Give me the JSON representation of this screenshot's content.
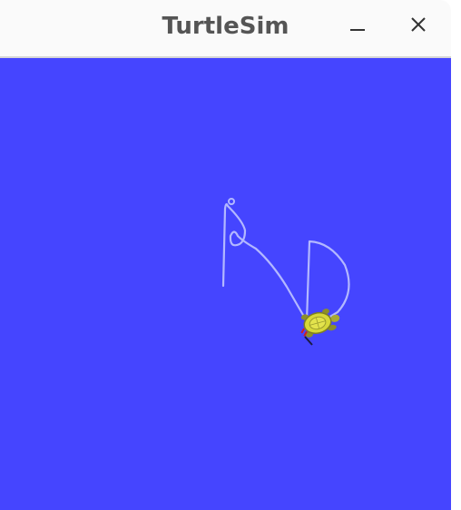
{
  "window": {
    "title": "TurtleSim"
  },
  "titlebar": {
    "minimize_icon": "minimize-icon",
    "close_icon": "close-icon"
  },
  "colors": {
    "background": "#4545FF",
    "pen": "#B3B8FF",
    "turtle_shell": "#D7D83A",
    "titlebar": "#FAFAFA",
    "title_text": "#555555"
  }
}
